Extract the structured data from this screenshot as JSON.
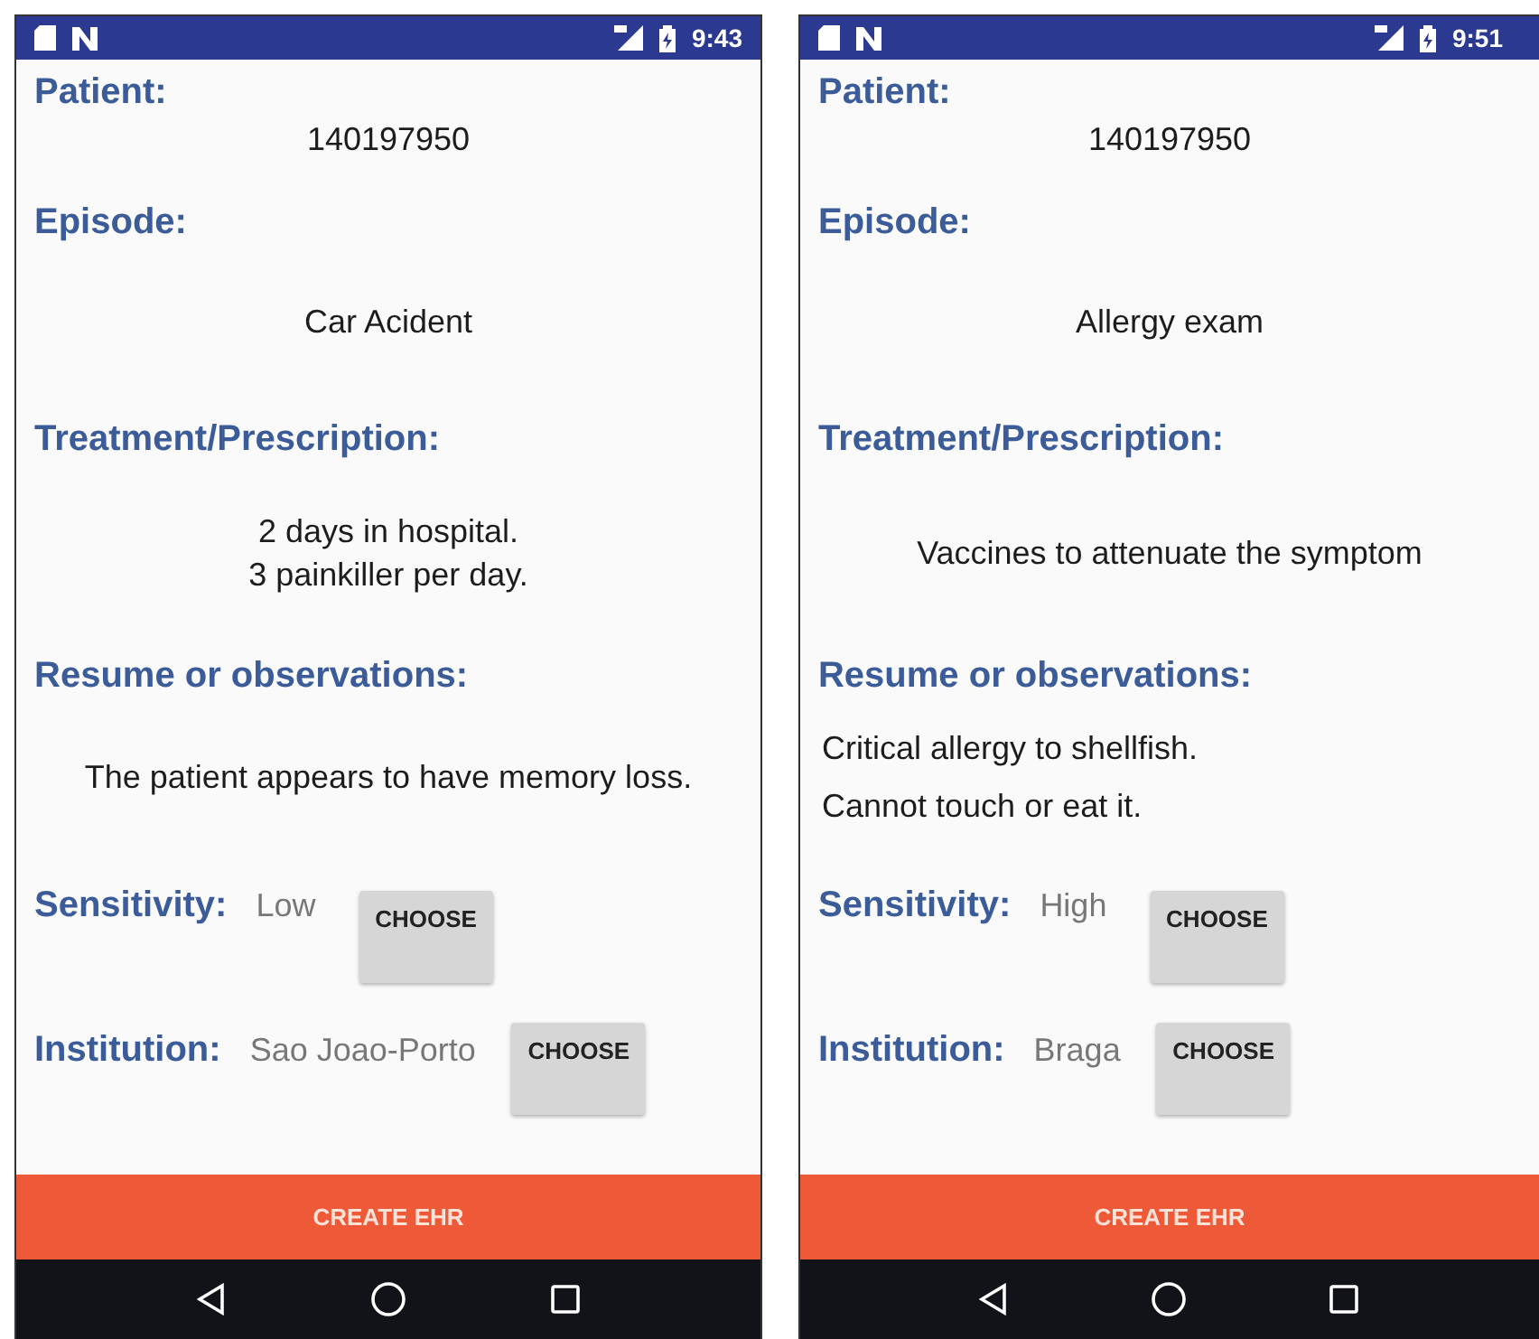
{
  "screens": [
    {
      "status_bar": {
        "time": "9:43"
      },
      "sections": [
        {
          "label": "Patient:",
          "lines": [
            "140197950"
          ],
          "kind": "centered"
        },
        {
          "label": "Episode:",
          "lines": [
            "Car Acident"
          ],
          "kind": "centered"
        },
        {
          "label": "Treatment/Prescription:",
          "lines": [
            "2 days in hospital.",
            "3 painkiller per day."
          ],
          "kind": "centered"
        },
        {
          "label": "Resume or observations:",
          "lines": [
            "The patient appears to have memory loss."
          ],
          "kind": "centered"
        }
      ],
      "choices": [
        {
          "label": "Sensitivity:",
          "value": "Low",
          "button": "CHOOSE"
        },
        {
          "label": "Institution:",
          "value": "Sao Joao-Porto",
          "button": "CHOOSE"
        }
      ],
      "action_button": "CREATE EHR"
    },
    {
      "status_bar": {
        "time": "9:51"
      },
      "sections": [
        {
          "label": "Patient:",
          "lines": [
            "140197950"
          ],
          "kind": "centered"
        },
        {
          "label": "Episode:",
          "lines": [
            "Allergy exam"
          ],
          "kind": "centered"
        },
        {
          "label": "Treatment/Prescription:",
          "lines": [
            "Vaccines to attenuate the symptom"
          ],
          "kind": "centered"
        },
        {
          "label": "Resume or observations:",
          "lines": [
            "Critical allergy to shellfish.",
            "Cannot touch or eat it."
          ],
          "kind": "flush"
        }
      ],
      "choices": [
        {
          "label": "Sensitivity:",
          "value": "High",
          "button": "CHOOSE"
        },
        {
          "label": "Institution:",
          "value": "Braga",
          "button": "CHOOSE"
        }
      ],
      "action_button": "CREATE EHR"
    }
  ]
}
